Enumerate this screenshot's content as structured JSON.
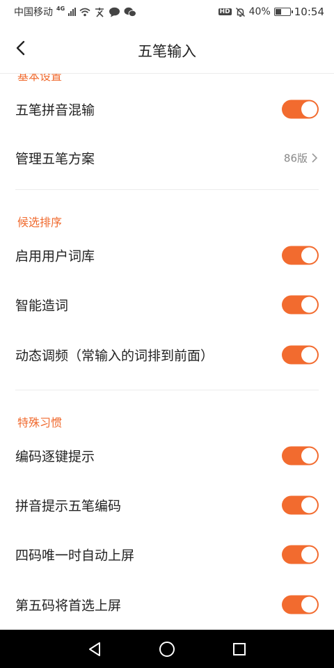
{
  "status": {
    "carrier": "中国移动",
    "net_badge": "4G",
    "hd_badge": "HD",
    "battery": "40%",
    "battery_level": 0.4,
    "time": "10:54"
  },
  "header": {
    "title": "五笔输入"
  },
  "sections": {
    "basic": {
      "title": "基本设置"
    },
    "candidates": {
      "title": "候选排序"
    },
    "habits": {
      "title": "特殊习惯"
    }
  },
  "rows": [
    {
      "label": "五笔拼音混输",
      "type": "toggle",
      "on": true
    },
    {
      "label": "管理五笔方案",
      "type": "link",
      "value": "86版"
    },
    {
      "label": "启用用户词库",
      "type": "toggle",
      "on": true
    },
    {
      "label": "智能造词",
      "type": "toggle",
      "on": true
    },
    {
      "label": "动态调频（常输入的词排到前面）",
      "type": "toggle",
      "on": true
    },
    {
      "label": "编码逐键提示",
      "type": "toggle",
      "on": true
    },
    {
      "label": "拼音提示五笔编码",
      "type": "toggle",
      "on": true
    },
    {
      "label": "四码唯一时自动上屏",
      "type": "toggle",
      "on": true
    },
    {
      "label": "第五码将首选上屏",
      "type": "toggle",
      "on": true
    }
  ],
  "colors": {
    "accent": "#f26b2f",
    "section_title": "#f06a2e",
    "nav_bar": "#000000"
  }
}
